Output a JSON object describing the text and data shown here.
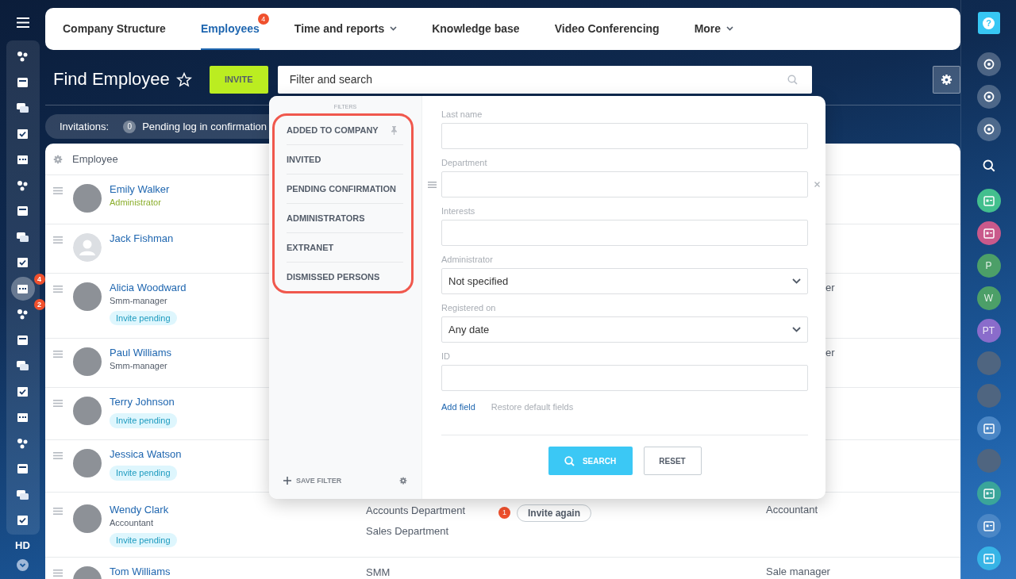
{
  "left_nav": {
    "items": [
      {
        "selected": false
      },
      {
        "selected": false
      },
      {
        "selected": false
      },
      {
        "selected": false
      },
      {
        "selected": false
      },
      {
        "selected": false
      },
      {
        "selected": false
      },
      {
        "selected": false
      },
      {
        "selected": false
      },
      {
        "selected": true,
        "badge": "4"
      },
      {
        "selected": false,
        "badge": "2"
      },
      {
        "selected": false
      },
      {
        "selected": false
      },
      {
        "selected": false
      },
      {
        "selected": false
      },
      {
        "selected": false
      },
      {
        "selected": false
      },
      {
        "selected": false
      },
      {
        "selected": false
      }
    ],
    "label": "HD"
  },
  "tabs": [
    {
      "label": "Company Structure",
      "selected": false
    },
    {
      "label": "Employees",
      "selected": true,
      "badge": "4"
    },
    {
      "label": "Time and reports",
      "selected": false,
      "caret": true
    },
    {
      "label": "Knowledge base",
      "selected": false
    },
    {
      "label": "Video Conferencing",
      "selected": false
    },
    {
      "label": "More",
      "selected": false,
      "caret": true
    }
  ],
  "header": {
    "title": "Find Employee",
    "invite_button": "INVITE",
    "search": {
      "placeholder": "Filter and search"
    }
  },
  "invitations": {
    "label": "Invitations:",
    "count": "0",
    "text": "Pending log in confirmation"
  },
  "table": {
    "column": "Employee",
    "rows": [
      {
        "name": "Emily Walker",
        "position": {
          "text": "Administrator",
          "kind": "admin"
        },
        "avatar": {
          "kind": "photo"
        }
      },
      {
        "name": "Jack Fishman",
        "avatar": {
          "kind": "silhouette"
        }
      },
      {
        "name": "Alicia Woodward",
        "position": {
          "text": "Smm-manager",
          "kind": "plain"
        },
        "status": "Invite pending",
        "avatar": {
          "kind": "photo"
        },
        "column_5": "er"
      },
      {
        "name": "Paul Williams",
        "position": {
          "text": "Smm-manager",
          "kind": "plain"
        },
        "avatar": {
          "kind": "photo"
        },
        "column_5": "er"
      },
      {
        "name": "Terry Johnson",
        "status": "Invite pending",
        "avatar": {
          "kind": "photo"
        }
      },
      {
        "name": "Jessica Watson",
        "status": "Invite pending",
        "avatar": {
          "kind": "photo"
        }
      },
      {
        "name": "Wendy Clark",
        "position": {
          "text": "Accountant",
          "kind": "plain"
        },
        "status": "Invite pending",
        "avatar": {
          "kind": "photo"
        },
        "departments": [
          "Accounts Department",
          "Sales Department"
        ],
        "invite_count": "1",
        "invite_again": "Invite again",
        "job": "Accountant"
      },
      {
        "name": "Tom Williams",
        "avatar": {
          "kind": "photo"
        },
        "departments": [
          "SMM"
        ],
        "job": "Sale manager"
      }
    ]
  },
  "filter_popup": {
    "title": "FILTERS",
    "presets_highlighted": true,
    "presets": [
      {
        "label": "ADDED TO COMPANY",
        "pinned": true
      },
      {
        "label": "INVITED",
        "pinned": false
      },
      {
        "label": "PENDING CONFIRMATION",
        "pinned": false
      },
      {
        "label": "ADMINISTRATORS",
        "pinned": false
      },
      {
        "label": "EXTRANET",
        "pinned": false
      },
      {
        "label": "DISMISSED PERSONS",
        "pinned": false
      }
    ],
    "save_filter": "SAVE FILTER",
    "fields": [
      {
        "kind": "text",
        "label": "Last name",
        "hovered": false
      },
      {
        "kind": "text",
        "label": "Department",
        "hovered": true
      },
      {
        "kind": "text",
        "label": "Interests",
        "hovered": false
      },
      {
        "kind": "select",
        "label": "Administrator",
        "value": "Not specified",
        "hovered": false
      },
      {
        "kind": "select",
        "label": "Registered on",
        "value": "Any date",
        "hovered": false
      },
      {
        "kind": "text",
        "label": "ID",
        "hovered": false
      }
    ],
    "add_field": "Add field",
    "restore": "Restore default fields",
    "search_button": "SEARCH",
    "reset_button": "RESET"
  },
  "right_nav": {
    "items": [
      {
        "kind": "help",
        "text": "?"
      },
      {
        "kind": "round"
      },
      {
        "kind": "round"
      },
      {
        "kind": "round"
      },
      {
        "kind": "search"
      },
      {
        "kind": "app",
        "color": "#43bf8e"
      },
      {
        "kind": "app",
        "color": "#c9598b"
      },
      {
        "kind": "initials",
        "text": "P",
        "color": "#4c9f68"
      },
      {
        "kind": "initials",
        "text": "W",
        "color": "#4c9f68"
      },
      {
        "kind": "initials",
        "text": "PT",
        "color": "#8a6ccb"
      },
      {
        "kind": "photo"
      },
      {
        "kind": "photo"
      },
      {
        "kind": "app",
        "color": "#4b87c6"
      },
      {
        "kind": "photo"
      },
      {
        "kind": "app",
        "color": "#3aa59a"
      },
      {
        "kind": "app",
        "color": "#4b87c6"
      },
      {
        "kind": "app",
        "color": "#37b4e6"
      }
    ]
  }
}
